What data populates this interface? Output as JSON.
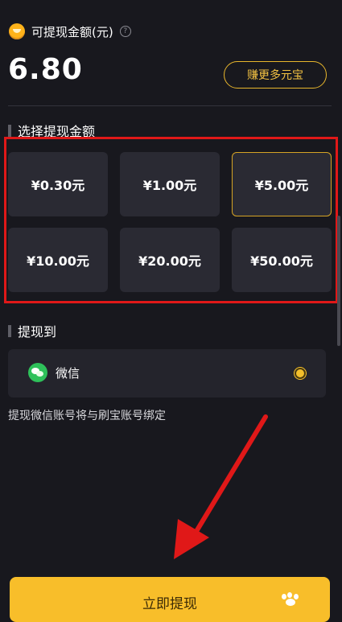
{
  "balance": {
    "label": "可提现金额(元)",
    "amount": "6.80",
    "earn_more": "赚更多元宝",
    "help_icon": "?"
  },
  "select_amount": {
    "title": "选择提现金额",
    "options": [
      "¥0.30元",
      "¥1.00元",
      "¥5.00元",
      "¥10.00元",
      "¥20.00元",
      "¥50.00元"
    ],
    "selected_index": 2
  },
  "withdraw_to": {
    "title": "提现到",
    "method": "微信",
    "note": "提现微信账号将与刷宝账号绑定"
  },
  "submit": {
    "label": "立即提现"
  },
  "colors": {
    "background": "#18181e",
    "accent": "#f8be2a",
    "annotation": "#e01818"
  }
}
